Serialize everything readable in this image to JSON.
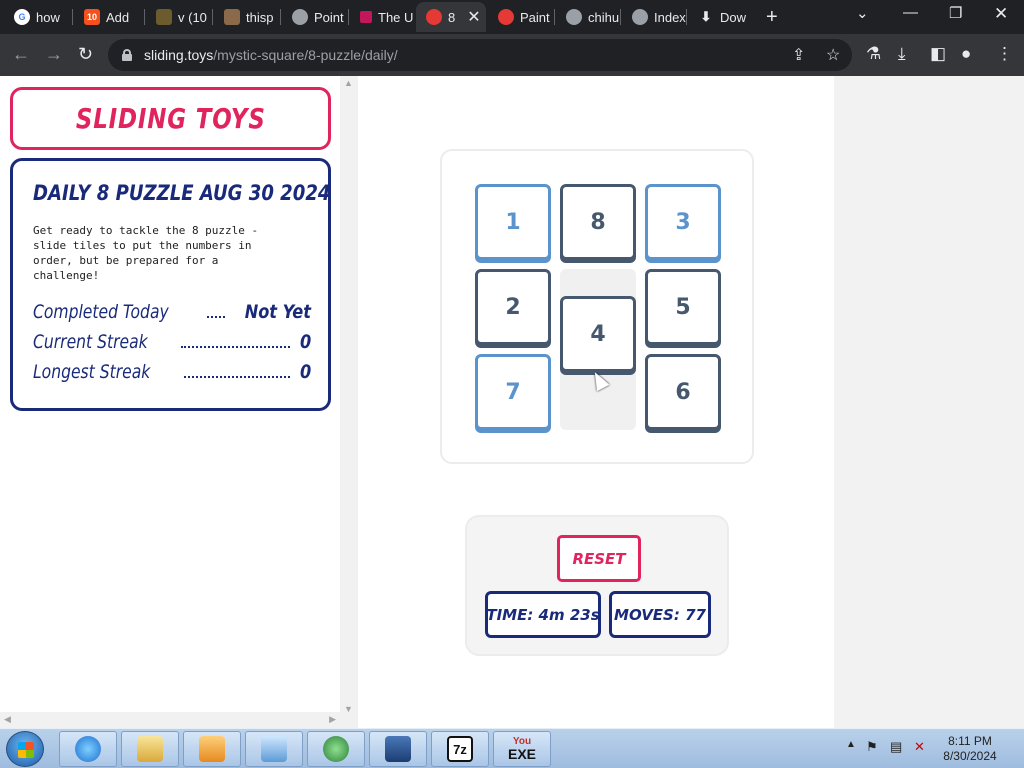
{
  "browser": {
    "tabs": [
      {
        "label": "how",
        "fav_color": "#fff",
        "fav_text": "G"
      },
      {
        "label": "Add",
        "fav_color": "#f4511e",
        "fav_text": "10"
      },
      {
        "label": "v (10",
        "fav_color": "#6b5b2e",
        "fav_text": ""
      },
      {
        "label": "thisp",
        "fav_color": "#8a6a4a",
        "fav_text": ""
      },
      {
        "label": "Point",
        "fav_color": "#9aa0a6",
        "fav_text": ""
      },
      {
        "label": "The U",
        "fav_color": "#c2185b",
        "fav_text": ""
      },
      {
        "label": "8",
        "fav_color": "#e53935",
        "fav_text": ""
      },
      {
        "label": "Paint",
        "fav_color": "#e53935",
        "fav_text": ""
      },
      {
        "label": "chihu",
        "fav_color": "#9aa0a6",
        "fav_text": ""
      },
      {
        "label": "Index",
        "fav_color": "#9aa0a6",
        "fav_text": ""
      },
      {
        "label": "Dow",
        "fav_color": "#202124",
        "fav_text": "⬇"
      }
    ],
    "url_host": "sliding.toys",
    "url_path": "/mystic-square/8-puzzle/daily/"
  },
  "sidebar": {
    "logo": "SLIDING TOYS",
    "title": "DAILY 8 PUZZLE AUG 30 2024",
    "description": "Get ready to tackle the 8 puzzle - slide tiles to put the numbers in order, but be prepared for a challenge!",
    "stats": [
      {
        "label": "Completed Today",
        "value": "Not Yet"
      },
      {
        "label": "Current Streak",
        "value": "0"
      },
      {
        "label": "Longest Streak",
        "value": "0"
      }
    ]
  },
  "puzzle": {
    "tiles": [
      {
        "label": "1",
        "home": true
      },
      {
        "label": "8",
        "home": false
      },
      {
        "label": "3",
        "home": true
      },
      {
        "label": "2",
        "home": false
      },
      {
        "label": "4",
        "home": false
      },
      {
        "label": "5",
        "home": false
      },
      {
        "label": "7",
        "home": true
      },
      {
        "label": "6",
        "home": false
      }
    ],
    "reset_label": "RESET",
    "time_label": "TIME: 4m 23s",
    "moves_label": "MOVES: 77"
  },
  "taskbar": {
    "apps": [
      "internet-explorer",
      "file-explorer",
      "media-player",
      "control-panel",
      "browser",
      "network-app",
      "7zip",
      "youtube-exe"
    ],
    "apps_labels": {
      "7zip": "7z",
      "youtube": "You",
      "exe": "EXE"
    },
    "clock_time": "8:11 PM",
    "clock_date": "8/30/2024"
  }
}
